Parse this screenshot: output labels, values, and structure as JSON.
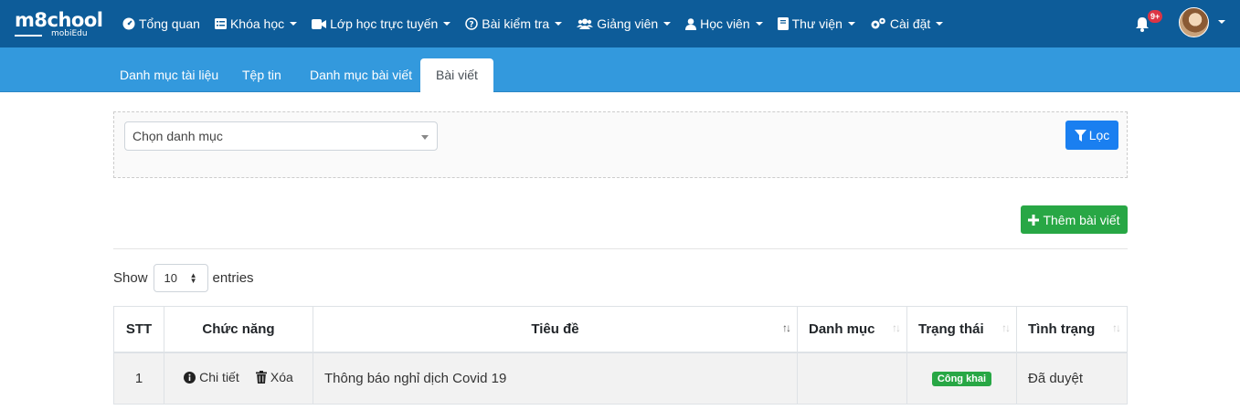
{
  "brand": {
    "logo_main": "m8chool",
    "logo_sub": "mobiEdu"
  },
  "nav": {
    "items": [
      {
        "label": "Tổng quan",
        "icon": "dashboard-icon",
        "caret": false
      },
      {
        "label": "Khóa học",
        "icon": "list-icon",
        "caret": true
      },
      {
        "label": "Lớp học trực tuyến",
        "icon": "video-icon",
        "caret": true
      },
      {
        "label": "Bài kiểm tra",
        "icon": "question-circle-icon",
        "caret": true
      },
      {
        "label": "Giảng viên",
        "icon": "users-icon",
        "caret": true
      },
      {
        "label": "Học viên",
        "icon": "user-icon",
        "caret": true
      },
      {
        "label": "Thư viện",
        "icon": "book-icon",
        "caret": true
      },
      {
        "label": "Cài đặt",
        "icon": "cogs-icon",
        "caret": true
      }
    ],
    "notification_badge": "9+"
  },
  "tabs": [
    {
      "label": "Danh mục tài liệu",
      "active": false
    },
    {
      "label": "Tệp tin",
      "active": false
    },
    {
      "label": "Danh mục bài viết",
      "active": false
    },
    {
      "label": "Bài viết",
      "active": true
    }
  ],
  "filter": {
    "select_placeholder": "Chọn danh mục",
    "filter_button": "Lọc"
  },
  "add_button": "Thêm bài viết",
  "table_length": {
    "show": "Show",
    "value": "10",
    "entries": "entries"
  },
  "table": {
    "headers": [
      "STT",
      "Chức năng",
      "Tiêu đề",
      "Danh mục",
      "Trạng thái",
      "Tình trạng"
    ],
    "rows": [
      {
        "stt": "1",
        "detail": "Chi tiết",
        "delete": "Xóa",
        "title": "Thông báo nghỉ dịch Covid 19",
        "category": "",
        "status": "Công khai",
        "state": "Đã duyệt"
      }
    ]
  },
  "colors": {
    "topbar": "#0d5c99",
    "subbar": "#3399dd",
    "primary": "#1a7ff0",
    "success": "#28a745",
    "danger": "#dc3545"
  }
}
